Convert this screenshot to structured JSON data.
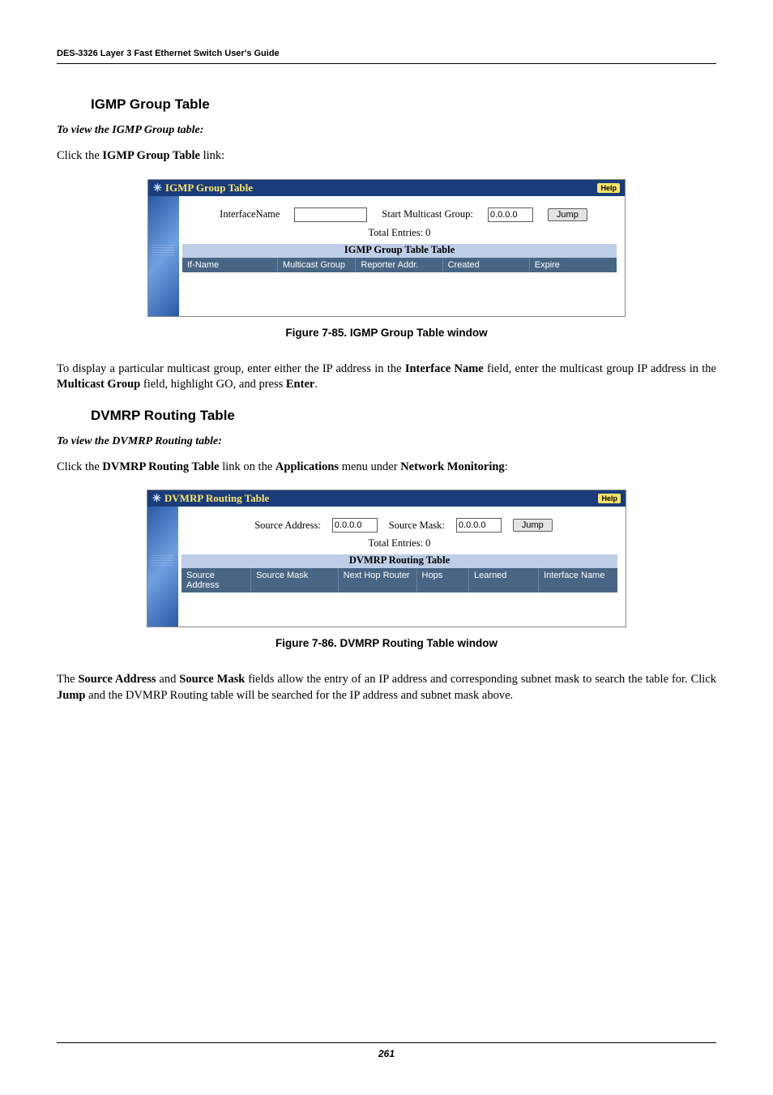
{
  "header": {
    "doc_title": "DES-3326 Layer 3 Fast Ethernet Switch User's Guide"
  },
  "section_igmp": {
    "title": "IGMP Group Table",
    "subhead": "To view the IGMP Group table:",
    "intro_pre": "Click the ",
    "intro_bold": "IGMP Group Table",
    "intro_post": " link:",
    "caption": "Figure 7-85.  IGMP Group Table window",
    "para": {
      "p1": "To display a particular multicast group, enter either the IP address in the ",
      "b1": "Interface Name",
      "p2": " field, enter the multicast group IP address in the ",
      "b2": "Multicast Group",
      "p3": " field, highlight GO, and press ",
      "b3": "Enter",
      "p4": "."
    },
    "panel": {
      "title": "IGMP Group Table",
      "help": "Help",
      "label_interface": "InterfaceName",
      "label_smg": "Start Multicast Group:",
      "smg_value": "0.0.0.0",
      "jump": "Jump",
      "total": "Total Entries: 0",
      "subheader": "IGMP Group Table Table",
      "cols": [
        "If-Name",
        "Multicast Group",
        "Reporter Addr.",
        "Created",
        "Expire"
      ]
    }
  },
  "section_dvmrp": {
    "title": "DVMRP Routing Table",
    "subhead": "To view the DVMRP Routing table:",
    "intro_pre": "Click the ",
    "intro_b1": "DVMRP Routing Table",
    "intro_mid1": " link on the ",
    "intro_b2": "Applications",
    "intro_mid2": " menu under ",
    "intro_b3": "Network Monitoring",
    "intro_post": ":",
    "caption": "Figure 7-86.  DVMRP Routing Table window",
    "para": {
      "p1": "The ",
      "b1": "Source Address",
      "p2": " and ",
      "b2": "Source Mask",
      "p3": " fields allow the entry of an IP address and corresponding subnet mask to search the table for. Click ",
      "b3": "Jump",
      "p4": " and the DVMRP Routing table will be searched for the IP address and subnet mask above."
    },
    "panel": {
      "title": "DVMRP Routing Table",
      "help": "Help",
      "label_src": "Source Address:",
      "src_value": "0.0.0.0",
      "label_mask": "Source Mask:",
      "mask_value": "0.0.0.0",
      "jump": "Jump",
      "total": "Total Entries: 0",
      "subheader": "DVMRP Routing Table",
      "cols": [
        "Source Address",
        "Source Mask",
        "Next Hop Router",
        "Hops",
        "Learned",
        "Interface Name"
      ]
    }
  },
  "footer": {
    "page": "261"
  }
}
